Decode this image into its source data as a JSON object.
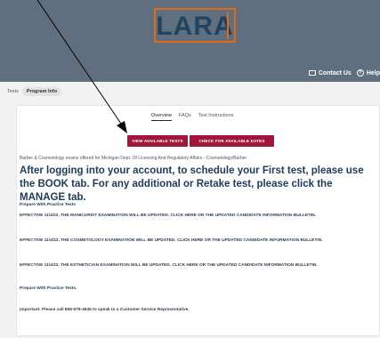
{
  "header": {
    "logo": "LARA",
    "contact_label": "Contact Us",
    "help_label": "Help"
  },
  "breadcrumb": {
    "items": [
      "Tests",
      "Program Info"
    ]
  },
  "tabs": [
    {
      "label": "Overview",
      "active": true
    },
    {
      "label": "FAQs",
      "active": false
    },
    {
      "label": "Test Instructions",
      "active": false
    }
  ],
  "buttons": {
    "view_tests": "VIEW AVAILABLE TESTS",
    "check_dates": "CHECK FOR AVAILABLE DATES"
  },
  "content": {
    "intro": "Barber & Cosmetology exams offered for Michigan Dept. Of Licensing And Regulatory Affairs - Cosmetology/Barber",
    "headline": "After logging into your account, to schedule your First test, please use the BOOK tab. For any additional or Retake test, please click the MANAGE tab.",
    "practice_1": "Prepare With Practice Tests",
    "manicurist": "EFFECTIVE 11/4/22, THE MANICURIST EXAMINATION WILL BE UPDATED. CLICK HERE OR THE UPDATED CANDIDATE INFORMATION BULLETIN.",
    "cosmetology": "EFFECTIVE 11/4/22, THE COSMETOLOGY EXAMINATION WILL BE UPDATED. CLICK HERE OR THE UPDATED CANDIDATE INFORMATION BULLETIN.",
    "esthetician": "EFFECTIVE 11/4/22, THE ESTHETICIAN EXAMINATION WILL BE UPDATED. CLICK HERE OR THE UPDATED CANDIDATE INFORMATION BULLETIN.",
    "practice_2": "Prepare With Practice Tests.",
    "important": "Important: Please call 855-579-4635 to speak to a Customer Service Representative."
  },
  "colors": {
    "header_bg": "#5f6f80",
    "logo_border": "#e06a12",
    "logo_text": "#20435f",
    "button_bg": "#a1163a",
    "headline": "#1d3a5a"
  }
}
